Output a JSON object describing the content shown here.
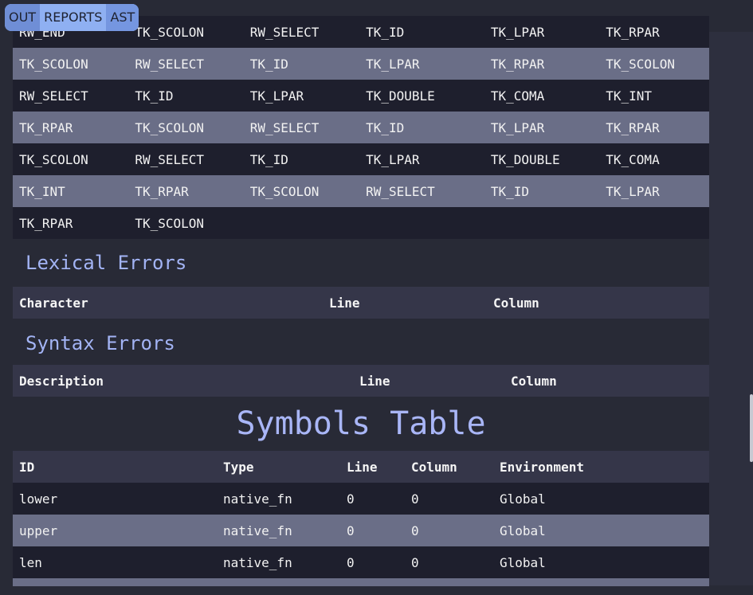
{
  "tabs": [
    "OUT",
    "REPORTS",
    "AST"
  ],
  "token_rows": [
    [
      "RW_END",
      "TK_SCOLON",
      "RW_SELECT",
      "TK_ID",
      "TK_LPAR",
      "TK_RPAR"
    ],
    [
      "TK_SCOLON",
      "RW_SELECT",
      "TK_ID",
      "TK_LPAR",
      "TK_RPAR",
      "TK_SCOLON"
    ],
    [
      "RW_SELECT",
      "TK_ID",
      "TK_LPAR",
      "TK_DOUBLE",
      "TK_COMA",
      "TK_INT"
    ],
    [
      "TK_RPAR",
      "TK_SCOLON",
      "RW_SELECT",
      "TK_ID",
      "TK_LPAR",
      "TK_RPAR"
    ],
    [
      "TK_SCOLON",
      "RW_SELECT",
      "TK_ID",
      "TK_LPAR",
      "TK_DOUBLE",
      "TK_COMA"
    ],
    [
      "TK_INT",
      "TK_RPAR",
      "TK_SCOLON",
      "RW_SELECT",
      "TK_ID",
      "TK_LPAR"
    ],
    [
      "TK_RPAR",
      "TK_SCOLON",
      "",
      "",
      "",
      ""
    ]
  ],
  "lexical": {
    "title": "Lexical Errors",
    "headers": [
      "Character",
      "Line",
      "Column"
    ]
  },
  "syntax": {
    "title": "Syntax Errors",
    "headers": [
      "Description",
      "Line",
      "Column"
    ]
  },
  "symbols": {
    "title": "Symbols Table",
    "headers": [
      "ID",
      "Type",
      "Line",
      "Column",
      "Environment"
    ],
    "rows": [
      [
        "lower",
        "native_fn",
        "0",
        "0",
        "Global"
      ],
      [
        "upper",
        "native_fn",
        "0",
        "0",
        "Global"
      ],
      [
        "len",
        "native_fn",
        "0",
        "0",
        "Global"
      ]
    ]
  },
  "colors": {
    "background": "#282a36",
    "row_dark": "#1e1f2d",
    "row_light": "#6a6e87",
    "accent": "#a3b4f5",
    "tab_bar": "#8fb0f2"
  }
}
